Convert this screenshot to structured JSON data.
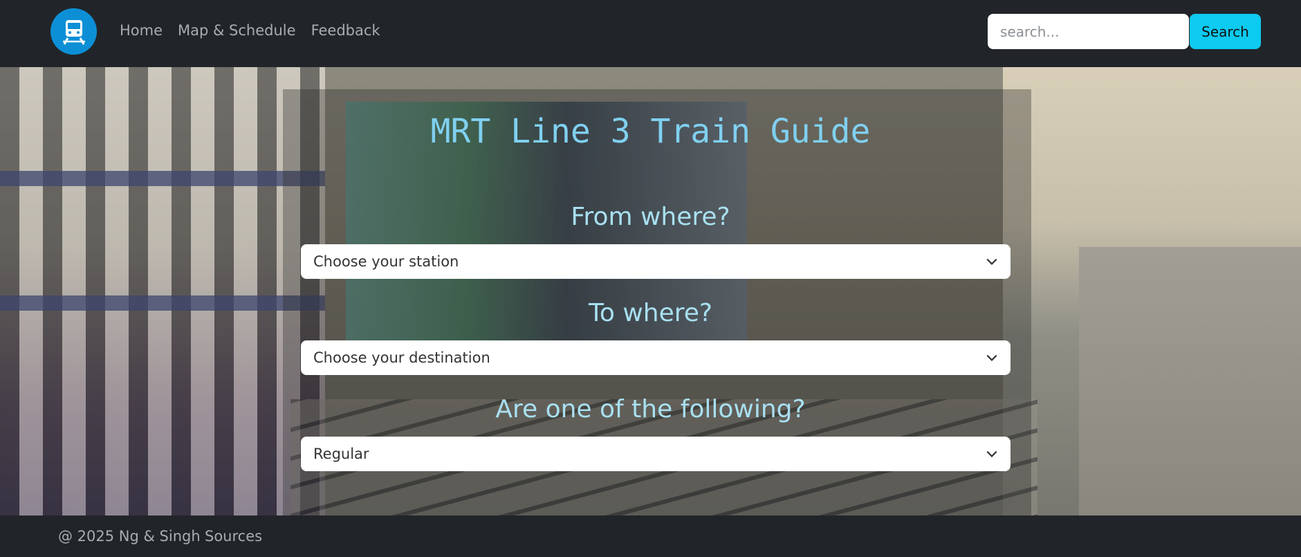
{
  "nav": {
    "logo_icon": "train-icon",
    "links": [
      "Home",
      "Map & Schedule",
      "Feedback"
    ],
    "search_placeholder": "search...",
    "search_button": "Search"
  },
  "main": {
    "title": "MRT Line 3 Train Guide",
    "from_label": "From where?",
    "from_select": "Choose your station",
    "to_label": "To where?",
    "to_select": "Choose your destination",
    "type_label": "Are one of the following?",
    "type_select": "Regular"
  },
  "footer": {
    "copyright": "@ 2025 Ng & Singh",
    "sources": "Sources"
  },
  "colors": {
    "nav_bg": "#212529",
    "search_button_bg": "#0dcaf0",
    "logo_bg": "#0d8fd6",
    "title": "#80d0f0"
  }
}
